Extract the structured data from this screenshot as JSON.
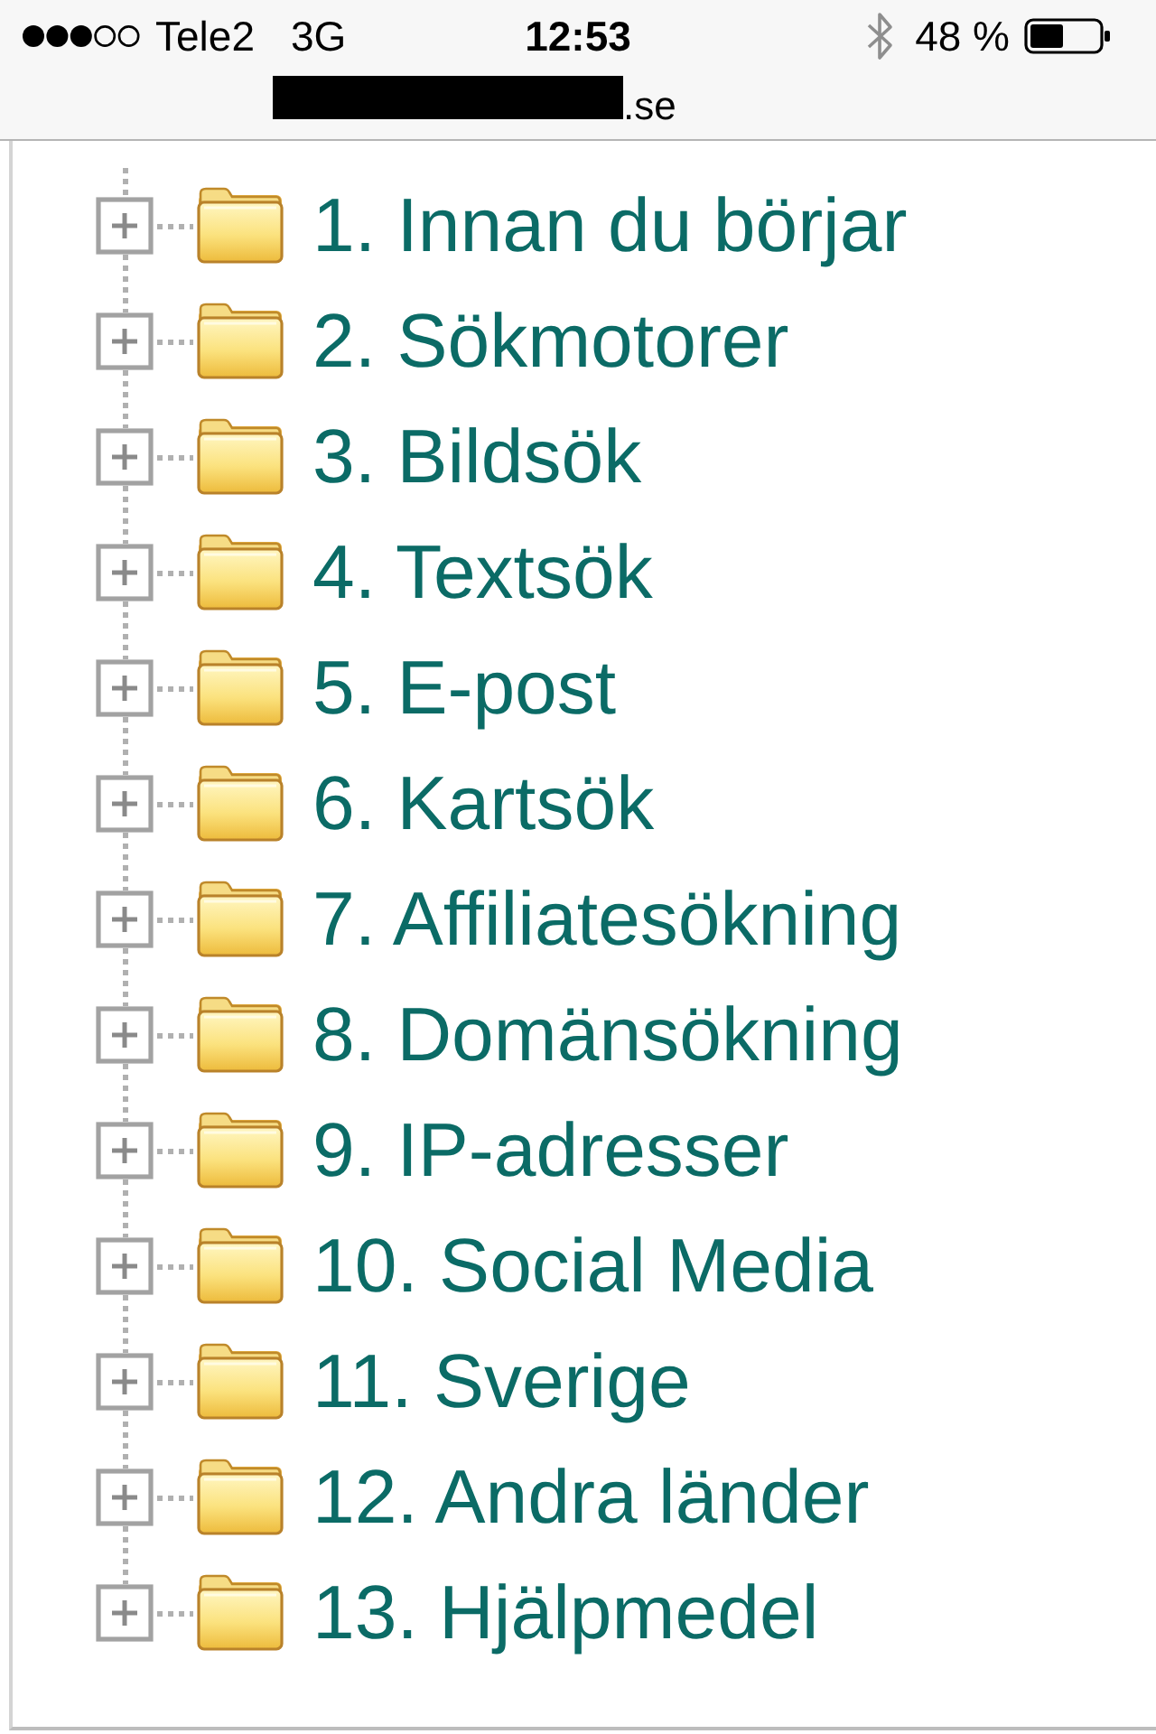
{
  "status_bar": {
    "carrier": "Tele2",
    "network": "3G",
    "time": "12:53",
    "battery_text": "48 %"
  },
  "address_bar": {
    "redacted": true,
    "url_text": ".se"
  },
  "tree": {
    "items": [
      {
        "label": "1. Innan du börjar",
        "expanded": false
      },
      {
        "label": "2. Sökmotorer",
        "expanded": false
      },
      {
        "label": "3. Bildsök",
        "expanded": false
      },
      {
        "label": "4. Textsök",
        "expanded": false
      },
      {
        "label": "5. E-post",
        "expanded": false
      },
      {
        "label": "6. Kartsök",
        "expanded": false
      },
      {
        "label": "7. Affiliatesökning",
        "expanded": false
      },
      {
        "label": "8. Domänsökning",
        "expanded": false
      },
      {
        "label": "9. IP-adresser",
        "expanded": false
      },
      {
        "label": "10. Social Media",
        "expanded": false
      },
      {
        "label": "11. Sverige",
        "expanded": false
      },
      {
        "label": "12. Andra länder",
        "expanded": false
      },
      {
        "label": "13. Hjälpmedel",
        "expanded": false
      }
    ]
  }
}
